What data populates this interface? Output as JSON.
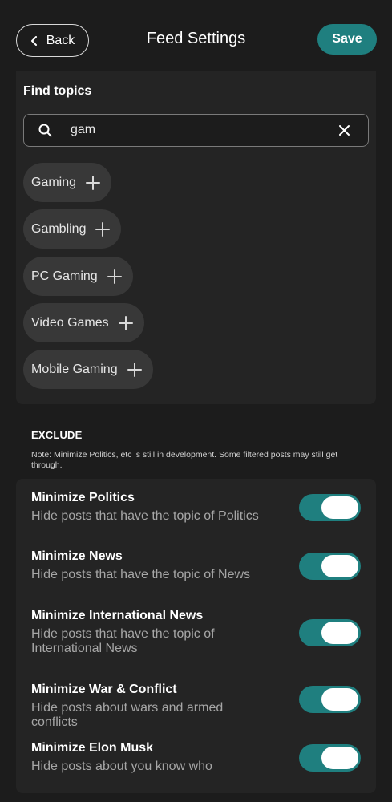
{
  "header": {
    "back_label": "Back",
    "title": "Feed Settings",
    "save_label": "Save"
  },
  "topics": {
    "heading": "Find topics",
    "search_value": "gam",
    "chips": [
      "Gaming",
      "Gambling",
      "PC Gaming",
      "Video Games",
      "Mobile Gaming"
    ]
  },
  "exclude": {
    "heading": "EXCLUDE",
    "note": "Note: Minimize Politics, etc is still in development. Some filtered posts may still get through.",
    "items": [
      {
        "title": "Minimize Politics",
        "description": "Hide posts that have the topic of Politics",
        "enabled": true
      },
      {
        "title": "Minimize News",
        "description": "Hide posts that have the topic of News",
        "enabled": true
      },
      {
        "title": "Minimize International News",
        "description": "Hide posts that have the topic of International News",
        "enabled": true
      },
      {
        "title": "Minimize War & Conflict",
        "description": "Hide posts about wars and armed conflicts",
        "enabled": true
      },
      {
        "title": "Minimize Elon Musk",
        "description": "Hide posts about you know who",
        "enabled": true
      }
    ]
  },
  "colors": {
    "accent": "#1f7f7f",
    "background": "#1c1c1c",
    "panel": "#242424",
    "chip": "#383838"
  },
  "icons": {
    "back": "chevron-left-icon",
    "search": "search-icon",
    "clear": "close-icon",
    "add": "plus-icon"
  }
}
